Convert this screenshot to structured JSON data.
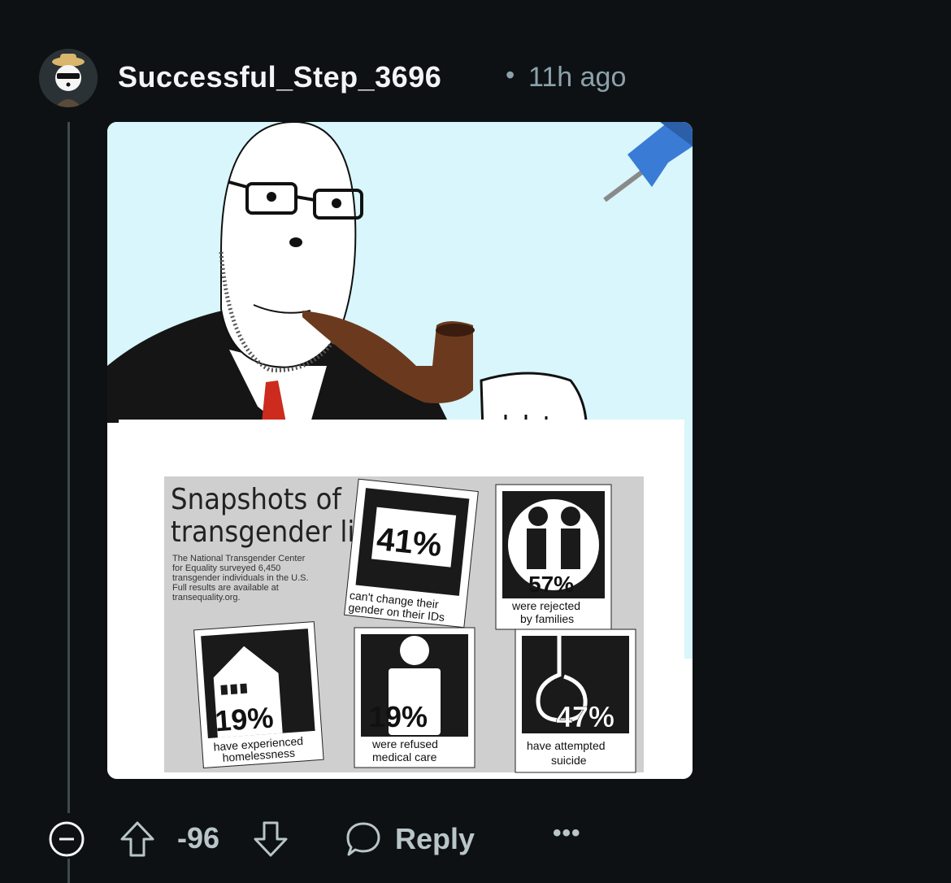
{
  "comment": {
    "username": "Successful_Step_3696",
    "separator": "•",
    "timestamp": "11h ago",
    "avatar_icon": "panda-avatar-icon"
  },
  "image": {
    "infographic": {
      "title_line1": "Snapshots of",
      "title_line2": "transgender life",
      "description_lines": [
        "The National Transgender Center",
        "for Equality surveyed 6,450",
        "transgender individuals in the U.S.",
        "Full results are available at",
        "transequality.org."
      ],
      "stats": [
        {
          "value": "41%",
          "caption1": "can't change their",
          "caption2": "gender on their IDs",
          "icon": "id-card-icon"
        },
        {
          "value": "57%",
          "caption1": "were rejected",
          "caption2": "by families",
          "icon": "family-icon"
        },
        {
          "value": "19%",
          "caption1": "have experienced",
          "caption2": "homelessness",
          "icon": "house-icon"
        },
        {
          "value": "19%",
          "caption1": "were refused",
          "caption2": "medical care",
          "icon": "person-icon"
        },
        {
          "value": "47%",
          "caption1": "have attempted",
          "caption2": "suicide",
          "icon": "noose-icon"
        }
      ]
    },
    "pin_icon": "pushpin-icon",
    "sky_color": "#d8f6fb"
  },
  "actions": {
    "score": "-96",
    "reply_label": "Reply",
    "more_label": "•••",
    "collapse_icon": "collapse-minus-icon",
    "upvote_icon": "upvote-arrow-icon",
    "downvote_icon": "downvote-arrow-icon",
    "reply_icon": "speech-bubble-icon"
  }
}
